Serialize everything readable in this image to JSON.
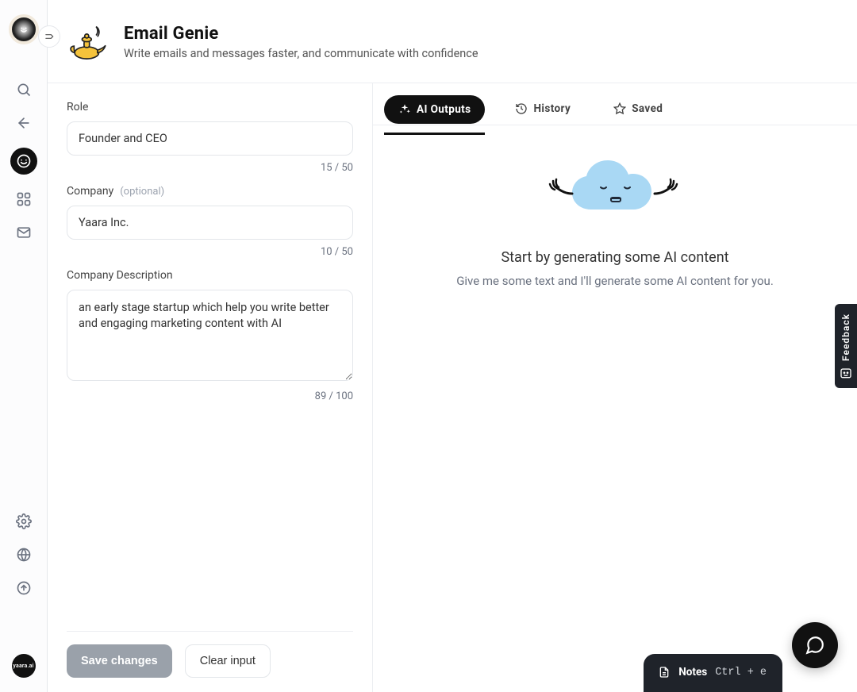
{
  "header": {
    "title": "Email Genie",
    "subtitle": "Write emails and messages faster, and communicate with confidence"
  },
  "rail": {
    "brand": "yaara.ai"
  },
  "form": {
    "role": {
      "label": "Role",
      "value": "Founder and CEO",
      "counter": "15 / 50"
    },
    "company": {
      "label": "Company",
      "optional": "(optional)",
      "value": "Yaara Inc.",
      "counter": "10 / 50"
    },
    "company_description": {
      "label": "Company Description",
      "value": "an early stage startup which help you write better and engaging marketing content with AI",
      "counter": "89 / 100"
    },
    "buttons": {
      "save": "Save changes",
      "clear": "Clear input"
    }
  },
  "tabs": {
    "outputs": "AI Outputs",
    "history": "History",
    "saved": "Saved"
  },
  "empty": {
    "title": "Start by generating some AI content",
    "subtitle": "Give me some text and I'll generate some AI content for you."
  },
  "notes": {
    "label": "Notes",
    "shortcut": "Ctrl + e"
  },
  "feedback": {
    "label": "Feedback"
  }
}
